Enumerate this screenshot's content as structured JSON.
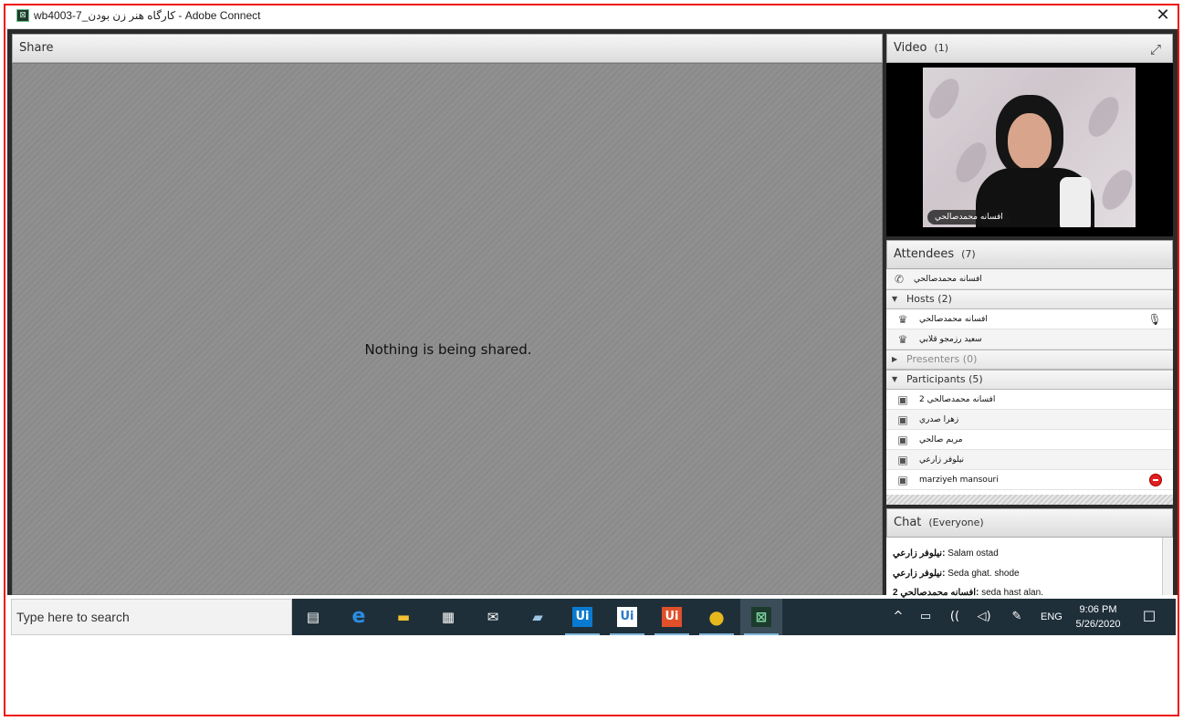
{
  "window": {
    "title": "wb4003-7_کارگاه هنر زن بودن - Adobe Connect",
    "close_glyph": "✕"
  },
  "share_pod": {
    "title": "Share",
    "message": "Nothing is being shared."
  },
  "video_pod": {
    "title": "Video",
    "count": "(1)",
    "fullscreen_icon": "fullscreen-icon",
    "speaker_name": "افسانه محمدصالحي"
  },
  "attendees_pod": {
    "title": "Attendees",
    "count": "(7)",
    "speaker_row": {
      "name": "افسانه محمدصالحي",
      "icon": "phone-icon"
    },
    "hosts": {
      "label": "Hosts (2)",
      "expanded": true,
      "items": [
        {
          "name": "افسانه محمدصالحي",
          "mic": true
        },
        {
          "name": "سعيد رزمجو قلابي",
          "mic": false
        }
      ]
    },
    "presenters": {
      "label": "Presenters (0)",
      "expanded": false
    },
    "participants": {
      "label": "Participants (5)",
      "expanded": true,
      "items": [
        {
          "name": "افسانه محمدصالحي 2"
        },
        {
          "name": "زهرا صدري"
        },
        {
          "name": "مريم صالحي"
        },
        {
          "name": "نيلوفر زارعي"
        },
        {
          "name": "marziyeh mansouri",
          "status": "away"
        }
      ]
    }
  },
  "chat_pod": {
    "title": "Chat",
    "scope": "(Everyone)",
    "messages": [
      {
        "sender": "نيلوفر زارعي",
        "text": "Salam ostad"
      },
      {
        "sender": "نيلوفر زارعي",
        "text": "Seda ghat. shode"
      },
      {
        "sender": "افسانه محمدصالحي 2",
        "text": "seda hast alan."
      }
    ]
  },
  "taskbar": {
    "search_placeholder": "Type here to search",
    "apps": [
      {
        "name": "task-view",
        "glyph": "▤"
      },
      {
        "name": "edge",
        "glyph": "e",
        "color": "#2b8de0"
      },
      {
        "name": "file-explorer",
        "glyph": "▬",
        "color": "#f2c230"
      },
      {
        "name": "store",
        "glyph": "▦",
        "color": "#ffffff"
      },
      {
        "name": "mail",
        "glyph": "✉",
        "color": "#ffffff"
      },
      {
        "name": "notepad",
        "glyph": "▰",
        "color": "#9cc7e6"
      },
      {
        "name": "uipath-studio",
        "glyph": "Ui",
        "color": "#0a7ad0"
      },
      {
        "name": "uipath-robot",
        "glyph": "Ui",
        "color": "#2e79c9"
      },
      {
        "name": "uipath-assistant",
        "glyph": "Ui",
        "color": "#e0502a"
      },
      {
        "name": "chrome",
        "glyph": "●",
        "color": "#e6b81c"
      },
      {
        "name": "adobe-connect",
        "glyph": "⊠",
        "color": "#7fd6a4"
      }
    ],
    "tray": {
      "chevron": "^",
      "battery": "▭",
      "wifi": "((",
      "volume": "◁)",
      "pen": "✎",
      "language": "ENG"
    },
    "time": "9:06 PM",
    "date": "5/26/2020",
    "notification_icon": "☐"
  }
}
